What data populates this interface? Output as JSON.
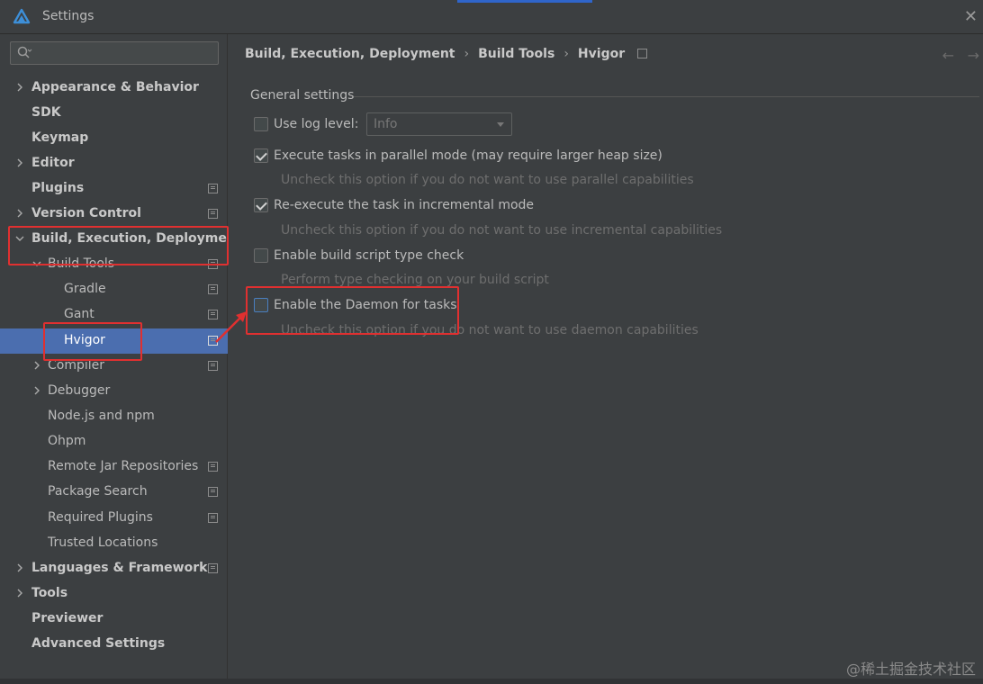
{
  "window": {
    "title": "Settings"
  },
  "search": {
    "placeholder": ""
  },
  "sidebar": {
    "items": [
      {
        "label": "Appearance & Behavior",
        "has_chevron": true,
        "expanded": false
      },
      {
        "label": "SDK"
      },
      {
        "label": "Keymap"
      },
      {
        "label": "Editor",
        "has_chevron": true,
        "expanded": false
      },
      {
        "label": "Plugins",
        "project_icon": true
      },
      {
        "label": "Version Control",
        "has_chevron": true,
        "expanded": false,
        "project_icon": true
      },
      {
        "label": "Build, Execution, Deployment",
        "has_chevron": true,
        "expanded": true
      },
      {
        "label": "Build Tools",
        "has_chevron": true,
        "expanded": true,
        "project_icon": true
      },
      {
        "label": "Gradle",
        "project_icon": true
      },
      {
        "label": "Gant",
        "project_icon": true
      },
      {
        "label": "Hvigor",
        "project_icon": true,
        "selected": true
      },
      {
        "label": "Compiler",
        "has_chevron": true,
        "expanded": false,
        "project_icon": true
      },
      {
        "label": "Debugger",
        "has_chevron": true,
        "expanded": false
      },
      {
        "label": "Node.js and npm"
      },
      {
        "label": "Ohpm"
      },
      {
        "label": "Remote Jar Repositories",
        "project_icon": true
      },
      {
        "label": "Package Search",
        "project_icon": true
      },
      {
        "label": "Required Plugins",
        "project_icon": true
      },
      {
        "label": "Trusted Locations"
      },
      {
        "label": "Languages & Frameworks",
        "has_chevron": true,
        "expanded": false,
        "project_icon": true
      },
      {
        "label": "Tools",
        "has_chevron": true,
        "expanded": false
      },
      {
        "label": "Previewer"
      },
      {
        "label": "Advanced Settings"
      }
    ]
  },
  "breadcrumb": {
    "items": [
      "Build, Execution, Deployment",
      "Build Tools",
      "Hvigor"
    ]
  },
  "main": {
    "group_title": "General settings",
    "log_level": {
      "label": "Use log level:",
      "checked": false,
      "value": "Info"
    },
    "options": [
      {
        "label": "Execute tasks in parallel mode (may require larger heap size)",
        "checked": true,
        "hint": "Uncheck this option if you do not want to use parallel capabilities"
      },
      {
        "label": "Re-execute the task in incremental mode",
        "checked": true,
        "hint": "Uncheck this option if you do not want to use incremental capabilities"
      },
      {
        "label": "Enable build script type check",
        "checked": false,
        "hint": "Perform type checking on your build script"
      },
      {
        "label": "Enable the Daemon for tasks",
        "checked": false,
        "hint": "Uncheck this option if you do not want to use daemon capabilities"
      }
    ]
  },
  "watermark": "@稀土掘金技术社区",
  "colors": {
    "selection": "#4b6eaf",
    "highlight": "#e03030",
    "background": "#3c3f41"
  }
}
